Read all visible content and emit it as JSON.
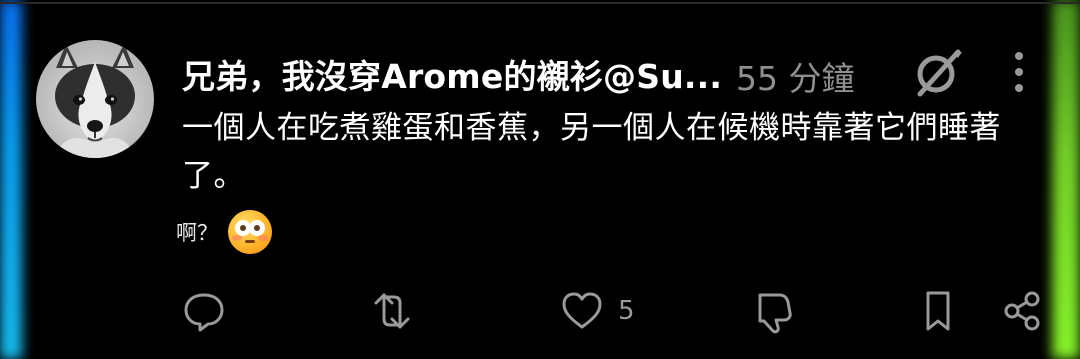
{
  "colors": {
    "background": "#000000",
    "text_primary": "#ffffff",
    "text_secondary": "#8f8f8f",
    "icon": "#9a9a9a",
    "emoji_face": "#ffb52b"
  },
  "post": {
    "author_display": "兄弟，我沒穿Arome的襯衫@Su...",
    "time_ago": "55 分鐘",
    "body": "一個人在吃煮雞蛋和香蕉，另一個人在候機時靠著它們睡著了。",
    "avatar_icon": "husky-dog-avatar",
    "grok_icon": "grok-icon",
    "more_icon": "more-vertical-icon"
  },
  "reply": {
    "text": "啊？",
    "emoji": "flushed-face-emoji"
  },
  "actions": {
    "reply_icon": "reply-icon",
    "repost_icon": "repost-icon",
    "like_icon": "like-icon",
    "like_count": "5",
    "dislike_icon": "dislike-icon",
    "bookmark_icon": "bookmark-icon",
    "share_icon": "share-icon"
  }
}
